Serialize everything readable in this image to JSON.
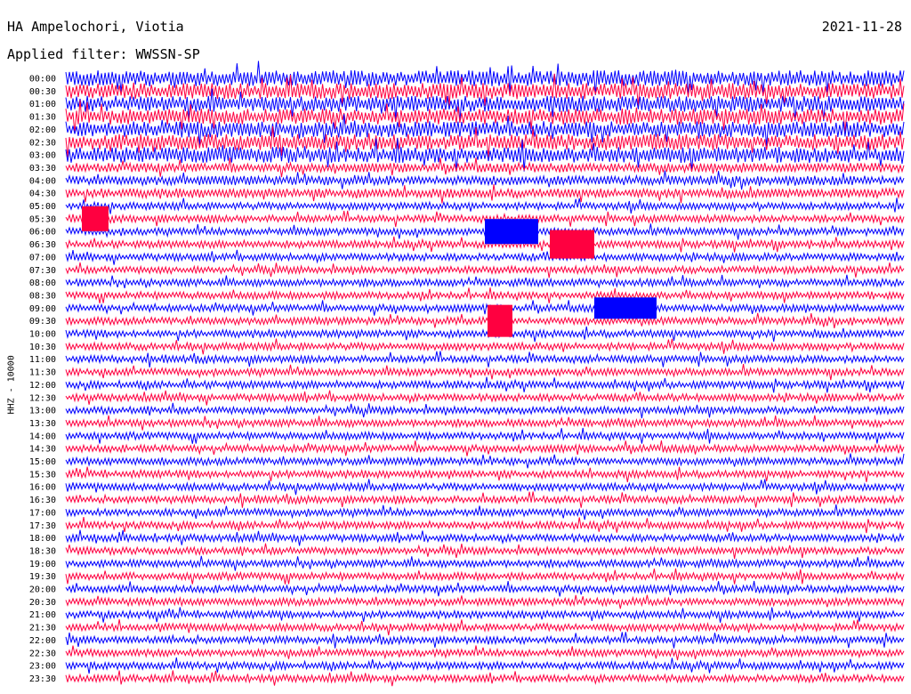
{
  "header": {
    "station": "HA Ampelochori, Viotia",
    "date": "2021-11-28",
    "filter": "Applied filter: WWSSN-SP"
  },
  "chart_data": {
    "type": "line",
    "ylabel": "HHZ - 10000",
    "row_labels": [
      "00:00",
      "00:30",
      "01:00",
      "01:30",
      "02:00",
      "02:30",
      "03:00",
      "03:30",
      "04:00",
      "04:30",
      "05:00",
      "05:30",
      "06:00",
      "06:30",
      "07:00",
      "07:30",
      "08:00",
      "08:30",
      "09:00",
      "09:30",
      "10:00",
      "10:30",
      "11:00",
      "11:30",
      "12:00",
      "12:30",
      "13:00",
      "13:30",
      "14:00",
      "14:30",
      "15:00",
      "15:30",
      "16:00",
      "16:30",
      "17:00",
      "17:30",
      "18:00",
      "18:30",
      "19:00",
      "19:30",
      "20:00",
      "20:30",
      "21:00",
      "21:30",
      "22:00",
      "22:30",
      "23:00",
      "23:30"
    ],
    "colors": [
      "#0000ff",
      "#ff0040"
    ],
    "grid": false
  }
}
